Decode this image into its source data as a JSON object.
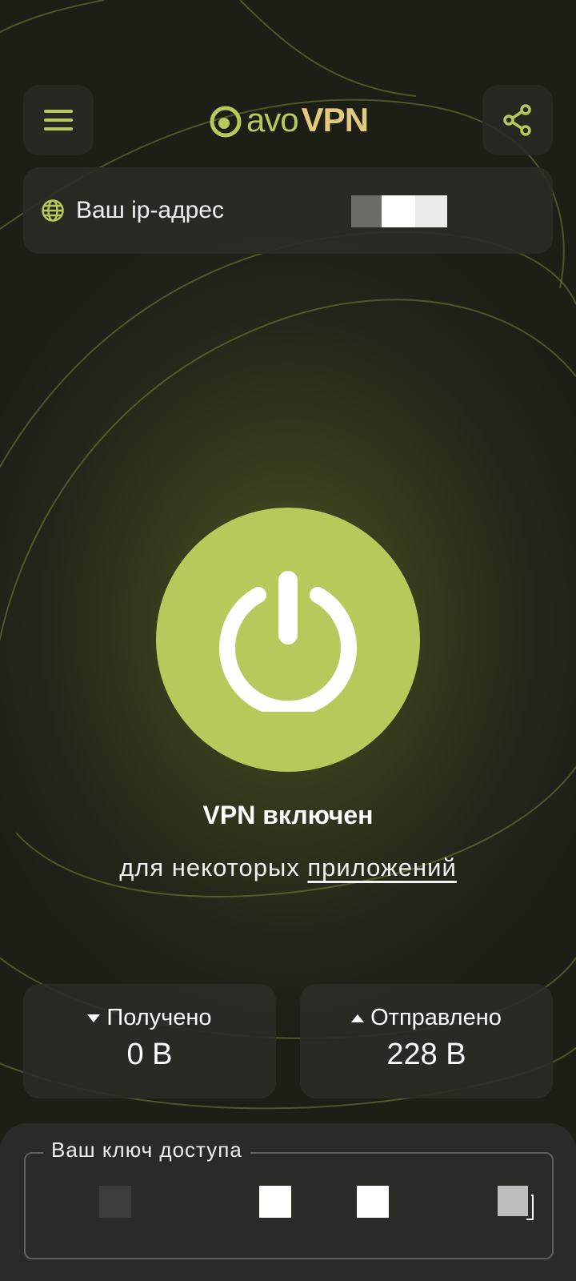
{
  "app": {
    "logo_prefix": "avo",
    "logo_suffix": "VPN",
    "accent_color": "#b6c95a",
    "brand_gold": "#e3c97e"
  },
  "header": {
    "menu_icon": "hamburger-menu-icon",
    "share_icon": "share-icon"
  },
  "ip_card": {
    "label": "Ваш ip-адрес",
    "icon": "globe-icon"
  },
  "status": {
    "title": "VPN включен",
    "subtitle_prefix": "для некоторых",
    "subtitle_link": "приложений",
    "power_icon": "power-icon"
  },
  "stats": {
    "received_label": "Получено",
    "received_value": "0 B",
    "sent_label": "Отправлено",
    "sent_value": "228 B"
  },
  "access_key": {
    "label": "Ваш ключ доступа",
    "copy_icon": "copy-icon"
  }
}
